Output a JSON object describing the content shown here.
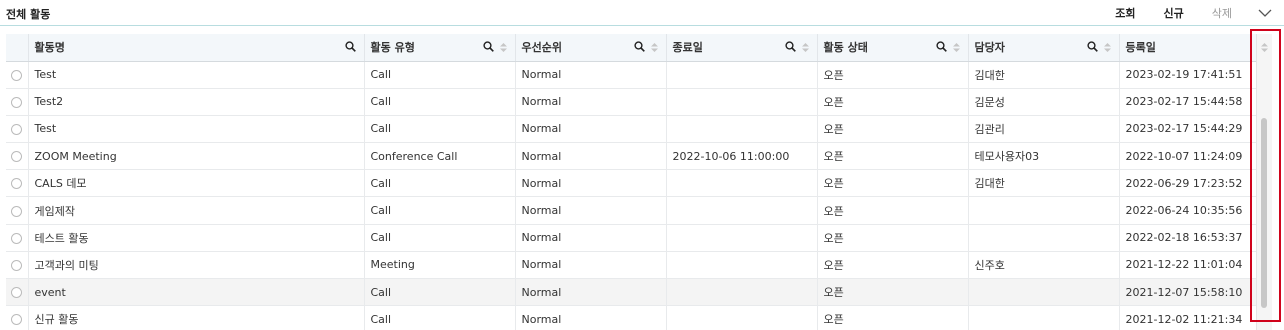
{
  "header": {
    "title": "전체 활동",
    "actions": {
      "search": "조회",
      "new": "신규",
      "delete": "삭제"
    }
  },
  "grid": {
    "columns": [
      {
        "label": "활동명",
        "search": true,
        "sort": false
      },
      {
        "label": "활동 유형",
        "search": true,
        "sort": true
      },
      {
        "label": "우선순위",
        "search": true,
        "sort": true
      },
      {
        "label": "종료일",
        "search": true,
        "sort": true
      },
      {
        "label": "활동 상태",
        "search": true,
        "sort": true
      },
      {
        "label": "담당자",
        "search": true,
        "sort": true
      },
      {
        "label": "등록일",
        "search": false,
        "sort": false
      }
    ],
    "rows": [
      [
        "Test",
        "Call",
        "Normal",
        "",
        "오픈",
        "김대한",
        "2023-02-19 17:41:51"
      ],
      [
        "Test2",
        "Call",
        "Normal",
        "",
        "오픈",
        "김문성",
        "2023-02-17 15:44:58"
      ],
      [
        "Test",
        "Call",
        "Normal",
        "",
        "오픈",
        "김관리",
        "2023-02-17 15:44:29"
      ],
      [
        "ZOOM Meeting",
        "Conference Call",
        "Normal",
        "2022-10-06 11:00:00",
        "오픈",
        "테모사용자03",
        "2022-10-07 11:24:09"
      ],
      [
        "CALS 데모",
        "Call",
        "Normal",
        "",
        "오픈",
        "김대한",
        "2022-06-29 17:23:52"
      ],
      [
        "게임제작",
        "Call",
        "Normal",
        "",
        "오픈",
        "",
        "2022-06-24 10:35:56"
      ],
      [
        "테스트 활동",
        "Call",
        "Normal",
        "",
        "오픈",
        "",
        "2022-02-18 16:53:37"
      ],
      [
        "고객과의 미팅",
        "Meeting",
        "Normal",
        "",
        "오픈",
        "신주호",
        "2021-12-22 11:01:04"
      ],
      [
        "event",
        "Call",
        "Normal",
        "",
        "오픈",
        "",
        "2021-12-07 15:58:10"
      ],
      [
        "신규 활동",
        "Call",
        "Normal",
        "",
        "오픈",
        "",
        "2021-12-02 11:21:34"
      ]
    ],
    "highlighted_row": 8
  },
  "colors": {
    "accent_border": "#b8dde0",
    "highlight": "#d0021b",
    "header_bg": "#f3f7fa"
  },
  "icons": {
    "search": "search-icon",
    "sort": "sort-icon",
    "collapse": "chevron-down-icon"
  }
}
